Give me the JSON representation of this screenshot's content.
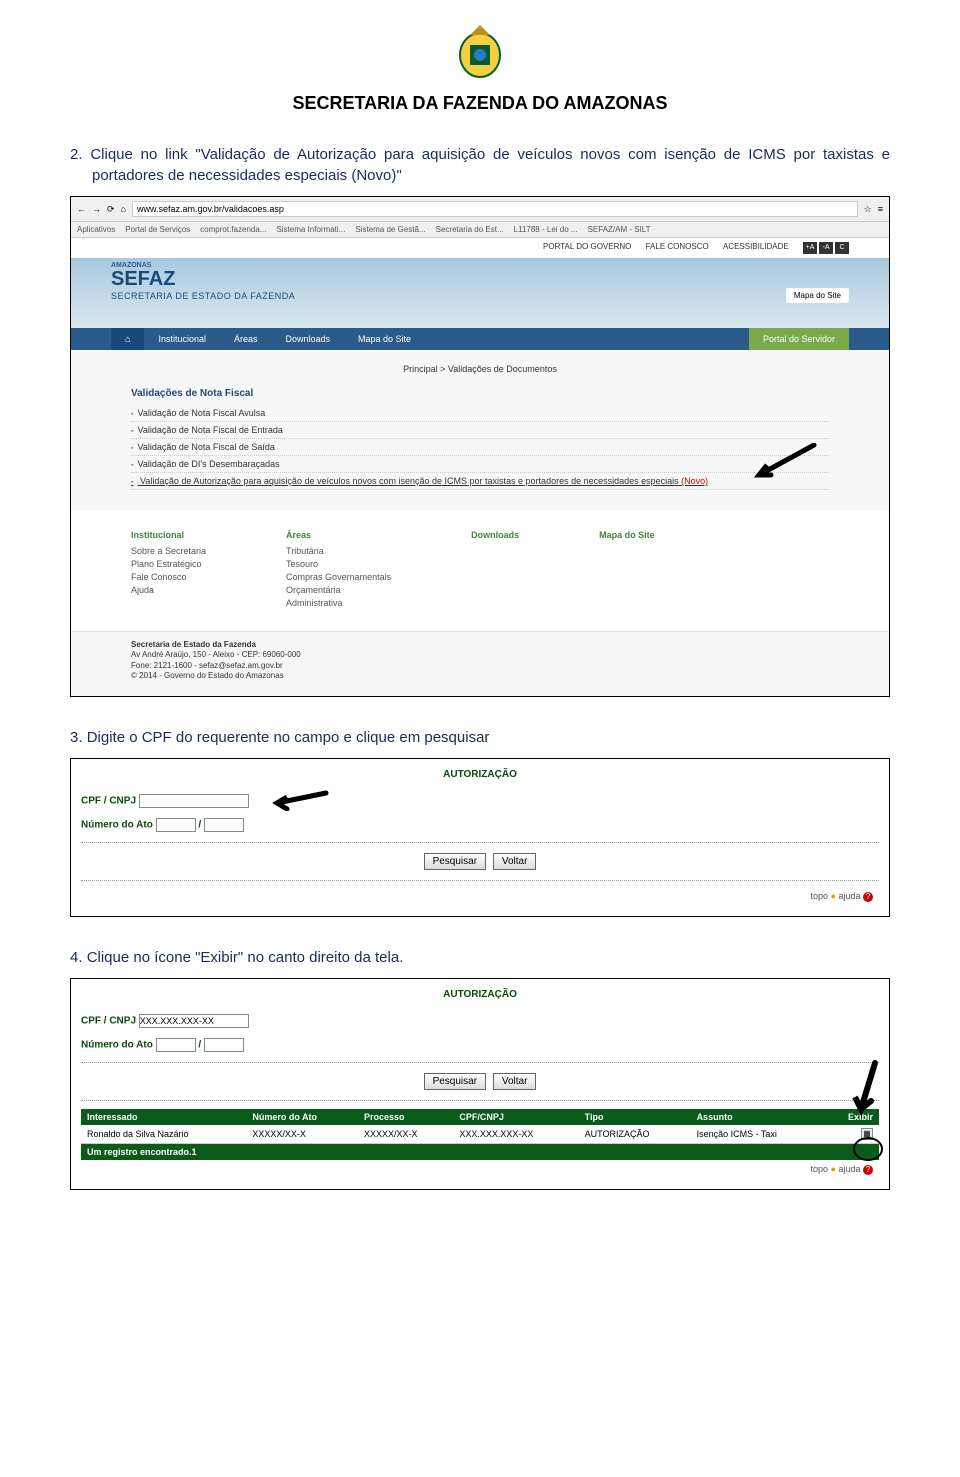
{
  "header": {
    "title": "SECRETARIA DA FAZENDA DO AMAZONAS"
  },
  "steps": {
    "s2_num": "2.",
    "s2_text": "Clique no link \"Validação de Autorização para aquisição de veículos novos com isenção de ICMS por taxistas e portadores de necessidades especiais (Novo)\"",
    "s3_num": "3.",
    "s3_text": "Digite o CPF do requerente no campo e clique em pesquisar",
    "s4_num": "4.",
    "s4_text": "Clique no ícone \"Exibir\" no canto direito da tela."
  },
  "screenshot1": {
    "url": "www.sefaz.am.gov.br/validacoes.asp",
    "bookmarks": [
      "Aplicativos",
      "Portal de Serviços",
      "comprot.fazenda...",
      "Sistema Informati...",
      "Sistema de Gestã...",
      "Secretaria do Est...",
      "L11788 - Lei do ...",
      "SEFAZ/AM - SILT"
    ],
    "portal_top": {
      "p1": "PORTAL DO GOVERNO",
      "p2": "FALE CONOSCO",
      "p3": "ACESSIBILIDADE"
    },
    "banner": {
      "logo": "SEFAZ",
      "subtitle": "SECRETARIA DE ESTADO DA FAZENDA",
      "mapa": "Mapa do Site"
    },
    "nav": {
      "home": "⌂",
      "n1": "Institucional",
      "n2": "Áreas",
      "n3": "Downloads",
      "n4": "Mapa do Site",
      "portal": "Portal do Servidor"
    },
    "breadcrumb": "Principal > Validações de Documentos",
    "section_title": "Validações de Nota Fiscal",
    "items": {
      "i1": "Validação de Nota Fiscal Avulsa",
      "i2": "Validação de Nota Fiscal de Entrada",
      "i3": "Validação de Nota Fiscal de Saída",
      "i4": "Validação de DI's Desembaraçadas",
      "i5": "Validação de Autorização para aquisição de veículos novos com isenção de ICMS por taxistas e portadores de necessidades especiais",
      "i5_novo": "(Novo)"
    },
    "footer_cols": {
      "c1": {
        "h": "Institucional",
        "a": "Sobre a Secretaria",
        "b": "Plano Estratégico",
        "c": "Fale Conosco",
        "d": "Ajuda"
      },
      "c2": {
        "h": "Áreas",
        "a": "Tributária",
        "b": "Tesouro",
        "c": "Compras Governamentais",
        "d": "Orçamentária",
        "e": "Administrativa"
      },
      "c3": {
        "h": "Downloads"
      },
      "c4": {
        "h": "Mapa do Site"
      }
    },
    "address": {
      "l1": "Secretaria de Estado da Fazenda",
      "l2": "Av André Araújo, 150 - Aleixo - CEP: 69060-000",
      "l3": "Fone: 2121-1600 - sefaz@sefaz.am.gov.br",
      "l4": "© 2014 - Governo do Estado do Amazonas"
    }
  },
  "screenshot2": {
    "title": "AUTORIZAÇÃO",
    "cpf_label": "CPF / CNPJ",
    "ato_label": "Número do Ato",
    "sep": "/",
    "btn_pesquisar": "Pesquisar",
    "btn_voltar": "Voltar",
    "topo": "topo",
    "ajuda": "ajuda"
  },
  "screenshot3": {
    "title": "AUTORIZAÇÃO",
    "cpf_label": "CPF / CNPJ",
    "cpf_value": "XXX.XXX.XXX-XX",
    "ato_label": "Número do Ato",
    "sep": "/",
    "btn_pesquisar": "Pesquisar",
    "btn_voltar": "Voltar",
    "table": {
      "h1": "Interessado",
      "h2": "Número do Ato",
      "h3": "Processo",
      "h4": "CPF/CNPJ",
      "h5": "Tipo",
      "h6": "Assunto",
      "h7": "Exibir",
      "r1": "Ronaldo da Silva Nazário",
      "r2": "XXXXX/XX-X",
      "r3": "XXXXX/XX-X",
      "r4": "XXX.XXX.XXX-XX",
      "r5": "AUTORIZAÇÃO",
      "r6": "Isenção ICMS - Taxi"
    },
    "footer": "Um registro encontrado.1",
    "topo": "topo",
    "ajuda": "ajuda"
  }
}
